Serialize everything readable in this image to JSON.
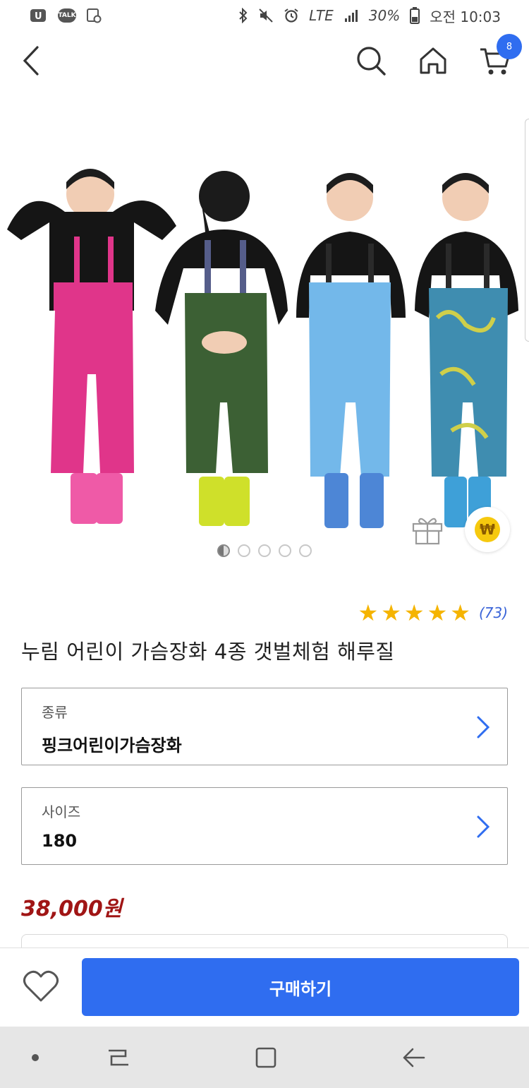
{
  "status_bar": {
    "network": "LTE",
    "battery": "30%",
    "time": "오전 10:03"
  },
  "header": {
    "cart_count": "8"
  },
  "gallery": {
    "image_count": 5,
    "active_index": 0,
    "won_symbol": "₩"
  },
  "product": {
    "rating_stars": 5,
    "review_count": "(73)",
    "title": "누림 어린이 가슴장화 4종 갯벌체험 해루질",
    "price": "38,000원"
  },
  "options": [
    {
      "label": "종류",
      "value": "핑크어린이가슴장화"
    },
    {
      "label": "사이즈",
      "value": "180"
    }
  ],
  "actions": {
    "buy_label": "구매하기"
  },
  "colors": {
    "accent": "#2f6df0",
    "price": "#a01515",
    "star": "#f5b400"
  }
}
